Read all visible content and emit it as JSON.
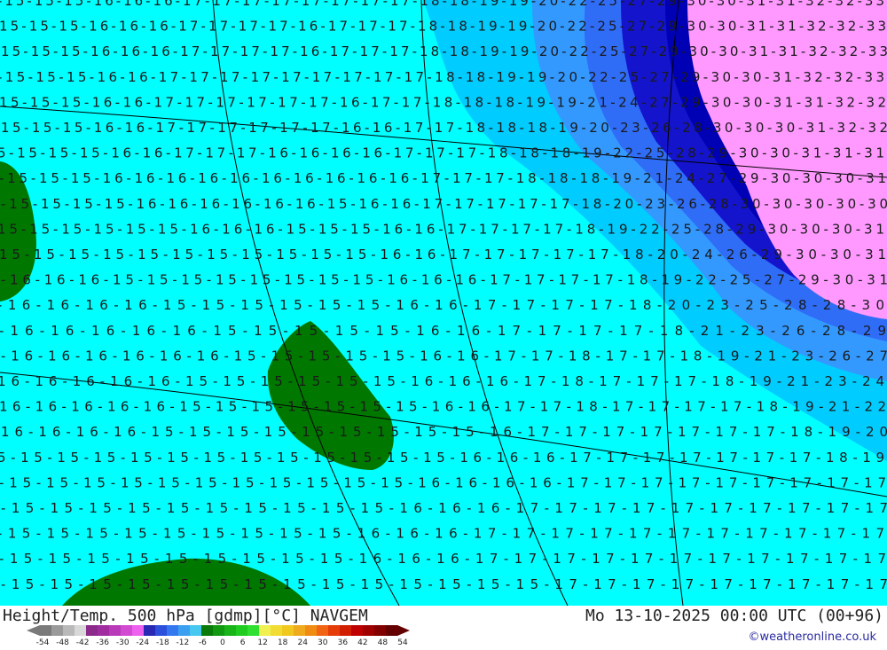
{
  "map": {
    "title": "Height/Temp. 500 hPa [gdmp][°C] NAVGEM",
    "valid_time": "Mo 13-10-2025 00:00 UTC (00+96)",
    "credit": "©weatheronline.co.uk",
    "background_color": "#00ffff",
    "region_colors": {
      "cyan": "#00ffff",
      "light_blue": "#00ccff",
      "mid_blue": "#3399ff",
      "blue": "#2f6df7",
      "deep_blue": "#1414cc",
      "navy": "#0000b4",
      "pink": "#ff99ff",
      "green": "#007800"
    },
    "label_rows": [
      "-15-15-15-16-16-16-17-17-17-17-17-17-17-17-18-18-19-19-20-22-25-27-29-30-30-31-31-32-32-33",
      "15-15-15-16-16-16-17-17-17-17-16-17-17-17-18-18-19-19-20-22-25-27-29-30-30-31-31-32-32-33",
      "15-15-15-16-16-16-17-17-17-17-16-17-17-17-18-18-19-19-20-22-25-27-29-30-30-31-31-32-32-33",
      "-15-15-15-16-16-17-17-17-17-17-17-17-17-17-18-18-19-19-20-22-25-27-29-30-30-31-32-32-33",
      "15-15-15-16-16-17-17-17-17-17-17-16-17-17-18-18-18-19-19-21-24-27-29-30-30-31-31-32-32",
      "15-15-15-16-16-17-17-17-17-17-17-16-16-17-17-18-18-18-19-20-23-26-28-30-30-30-31-32-32",
      "5-15-15-15-16-16-17-17-17-16-16-16-16-17-17-17-18-18-18-19-22-25-28-29-30-30-31-31-31",
      "-15-15-15-16-16-16-16-16-16-16-16-16-16-17-17-17-18-18-18-19-21-24-27-29-30-30-30-31",
      "-15-15-15-15-16-16-16-16-16-16-15-16-16-17-17-17-17-17-18-20-23-26-28-30-30-30-30-30",
      "15-15-15-15-15-15-16-16-16-15-15-15-16-16-17-17-17-17-18-19-22-25-28-29-30-30-30-31",
      "15-15-15-15-15-15-15-15-15-15-15-16-16-17-17-17-17-17-18-20-24-26-29-30-30-31",
      "-16-16-16-15-15-15-15-15-15-15-15-16-16-16-17-17-17-17-18-19-22-25-27-29-30-31",
      "-16-16-16-16-15-15-15-15-15-15-16-16-17-17-17-17-18-20-23-25-28-28-30",
      "-16-16-16-16-16-15-15-15-15-15-16-16-17-17-17-17-18-21-23-26-28-29",
      "-16-16-16-16-16-16-15-15-15-15-15-16-16-17-17-18-17-17-18-19-21-23-26-27",
      "16-16-16-16-16-15-15-15-15-15-15-16-16-16-17-18-17-17-17-18-19-21-23-24",
      "16-16-16-16-16-15-15-15-15-15-15-15-16-16-17-17-18-17-17-17-17-18-19-21-22",
      "16-16-16-16-15-15-15-15-15-15-15-15-15-16-17-17-17-17-17-17-17-18-19-20",
      "5-15-15-15-15-15-15-15-15-15-15-15-15-16-16-16-17-17-17-17-17-17-17-18-19",
      "-15-15-15-15-15-15-15-15-15-15-15-16-16-16-16-17-17-17-17-17-17-17-17-17",
      "-15-15-15-15-15-15-15-15-15-15-16-16-16-17-17-17-17-17-17-17-17-17-17",
      "-15-15-15-15-15-15-15-15-15-16-16-16-17-17-17-17-17-17-17-17-17-17-17",
      "-15-15-15-15-15-15-15-15-15-16-16-16-17-17-17-17-17-17-17-17-17-17-17",
      "-15-15-15-15-15-15-15-15-15-15-15-15-15-15-17-17-17-17-17-17-17-17-17"
    ]
  },
  "legend": {
    "colors": [
      "#7a7a7a",
      "#9a9a9a",
      "#b9b9b9",
      "#d8d8d8",
      "#8c2a8c",
      "#a02ca0",
      "#b93ab9",
      "#d24ad2",
      "#ee60ee",
      "#2828b4",
      "#2c50dc",
      "#3478f0",
      "#3ca0f0",
      "#46c8f0",
      "#0a7a0a",
      "#119911",
      "#18b418",
      "#20cc20",
      "#30e030",
      "#f0f050",
      "#f0dc32",
      "#f0c81e",
      "#f0aa1e",
      "#f08c14",
      "#f06414",
      "#e63c0a",
      "#d21e00",
      "#be0000",
      "#a00000",
      "#820000",
      "#640000"
    ],
    "tick_labels": [
      "-54",
      "-48",
      "-42",
      "-36",
      "-30",
      "-24",
      "-18",
      "-12",
      "-6",
      "0",
      "6",
      "12",
      "18",
      "24",
      "30",
      "36",
      "42",
      "48",
      "54"
    ]
  }
}
